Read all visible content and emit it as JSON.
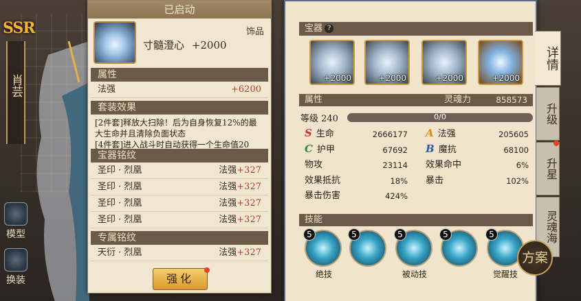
{
  "left": {
    "rarity": "SSR",
    "name": "肖芸",
    "buttons": [
      "模型",
      "换装"
    ]
  },
  "detail": {
    "title": "已启动",
    "item_name": "寸髓澄心",
    "item_bonus": "+2000",
    "item_type": "饰品",
    "attr_head": "属性",
    "attr_label": "法强",
    "attr_value": "+6200",
    "set_head": "套装效果",
    "set_text_1": "[2件套]释放大扫除！后为自身恢复12%的最大生命并且清除负面状态",
    "set_text_2": "[4件套]进入战斗时自动获得一个生命值20",
    "glyph_head": "宝器铭纹",
    "glyphs": [
      {
        "name": "圣印 · 烈凰",
        "stat": "法强",
        "value": "+327"
      },
      {
        "name": "圣印 · 烈凰",
        "stat": "法强",
        "value": "+327"
      },
      {
        "name": "圣印 · 烈凰",
        "stat": "法强",
        "value": "+327"
      },
      {
        "name": "圣印 · 烈凰",
        "stat": "法强",
        "value": "+327"
      }
    ],
    "exclusive_head": "专属铭纹",
    "exclusive": {
      "name": "天衍 · 烈凰",
      "stat": "法强",
      "value": "+327"
    },
    "strengthen_label": "强化"
  },
  "treasure": {
    "head": "宝器",
    "help": "?",
    "slots": [
      "+2000",
      "+2000",
      "+2000",
      "+2000"
    ]
  },
  "attributes": {
    "head": "属性",
    "soul_label": "灵魂力",
    "soul_value": "858573",
    "level_label": "等级 240",
    "level_progress": "0/0",
    "level_fraction": 0.0,
    "stats": [
      {
        "grade": "S",
        "label": "生命",
        "value": "2666177",
        "color": "#c0392b"
      },
      {
        "grade": "A",
        "label": "法强",
        "value": "205605",
        "color": "#d68a1a"
      },
      {
        "grade": "C",
        "label": "护甲",
        "value": "67692",
        "color": "#2e8b3a"
      },
      {
        "grade": "B",
        "label": "魔抗",
        "value": "68100",
        "color": "#2a5aa8"
      },
      {
        "grade": "",
        "label": "物攻",
        "value": "23114"
      },
      {
        "grade": "",
        "label": "效果命中",
        "value": "6%"
      },
      {
        "grade": "",
        "label": "效果抵抗",
        "value": "18%"
      },
      {
        "grade": "",
        "label": "暴击",
        "value": "102%"
      },
      {
        "grade": "",
        "label": "暴击伤害",
        "value": "424%"
      }
    ]
  },
  "skills": {
    "head": "技能",
    "levels": [
      "5",
      "5",
      "5",
      "5",
      "5"
    ],
    "labels": [
      "绝技",
      "被动技",
      "觉醒技"
    ]
  },
  "tabs": [
    "详情",
    "升级",
    "升星",
    "灵魂海"
  ],
  "plan_label": "方案"
}
